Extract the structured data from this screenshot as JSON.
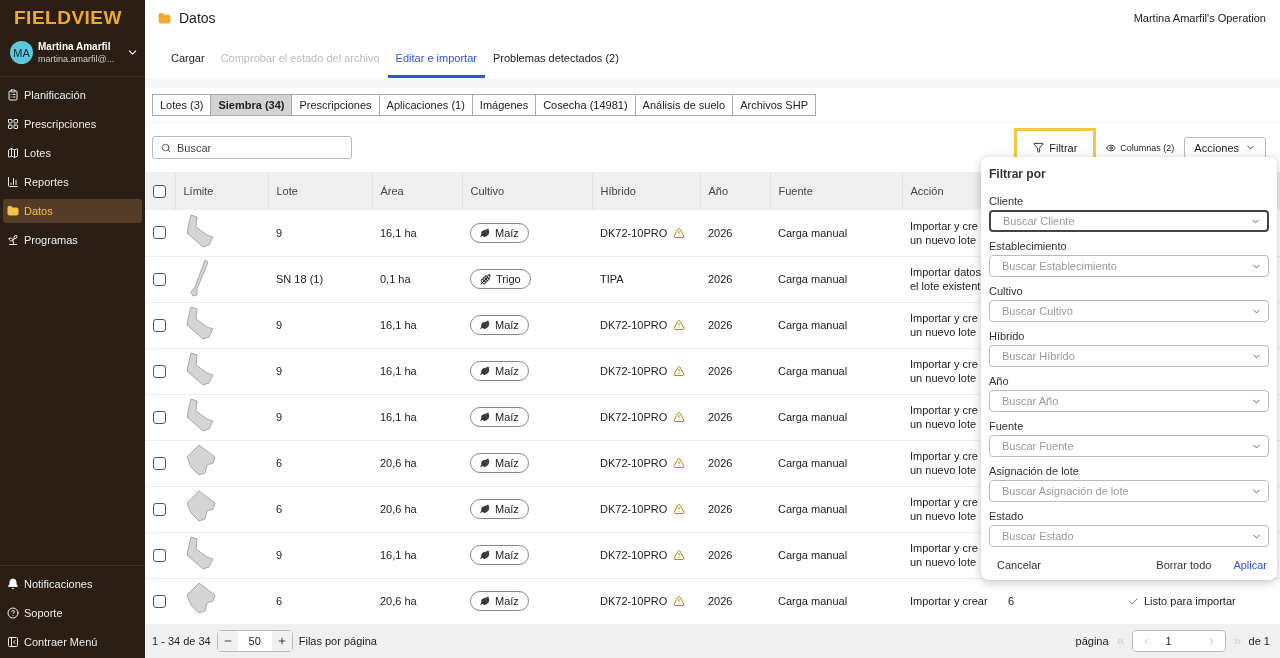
{
  "sidebar": {
    "logo": "FIELDVIEW",
    "user": {
      "initials": "MA",
      "name": "Martina Amarfil",
      "email": "martina.amarfil@..."
    },
    "items": [
      {
        "label": "Planificación",
        "selected": false
      },
      {
        "label": "Prescripciones",
        "selected": false
      },
      {
        "label": "Lotes",
        "selected": false
      },
      {
        "label": "Reportes",
        "selected": false
      },
      {
        "label": "Datos",
        "selected": true
      },
      {
        "label": "Programas",
        "selected": false
      }
    ],
    "bottom": [
      {
        "label": "Notificaciones"
      },
      {
        "label": "Soporte"
      },
      {
        "label": "Contraer Menú"
      }
    ]
  },
  "header": {
    "title": "Datos",
    "operation": "Martina Amarfil's Operation"
  },
  "steps": [
    {
      "label": "Cargar",
      "selected": false,
      "disabled": false
    },
    {
      "label": "Comprobar el estado del archivo",
      "selected": false,
      "disabled": true
    },
    {
      "label": "Editar e importar",
      "selected": true,
      "disabled": false
    },
    {
      "label": "Problemas detectados (2)",
      "selected": false,
      "disabled": false
    }
  ],
  "segments": [
    {
      "label": "Lotes (3)",
      "selected": false
    },
    {
      "label": "Siembra (34)",
      "selected": true
    },
    {
      "label": "Prescripciones",
      "selected": false
    },
    {
      "label": "Aplicaciones (1)",
      "selected": false
    },
    {
      "label": "Imágenes",
      "selected": false
    },
    {
      "label": "Cosecha (14981)",
      "selected": false
    },
    {
      "label": "Análisis de suelo",
      "selected": false
    },
    {
      "label": "Archivos SHP",
      "selected": false
    }
  ],
  "toolbar": {
    "search_placeholder": "Buscar",
    "filter": "Filtrar",
    "filter_highlighted": true,
    "columns": "Columnas (2)",
    "actions": "Acciones"
  },
  "table": {
    "all_checked": false,
    "columns": [
      "Límite",
      "Lote",
      "Área",
      "Cultivo",
      "Híbrido",
      "Año",
      "Fuente",
      "Acción"
    ],
    "rows": [
      {
        "checked": false,
        "lote": "9",
        "area": "16,1 ha",
        "crop": {
          "kind": "leaf",
          "label": "Maíz"
        },
        "hybrid": "DK72-10PRO",
        "warning": true,
        "year": "2026",
        "source": "Carga manual",
        "action": [
          "Importar y cre",
          "un nuevo lote"
        ]
      },
      {
        "checked": false,
        "lote": "SN 18 (1)",
        "area": "0,1 ha",
        "crop": {
          "kind": "wheat",
          "label": "Trigo"
        },
        "hybrid": "TIPA",
        "warning": false,
        "year": "2026",
        "source": "Carga manual",
        "action": [
          "Importar datos",
          "el lote existent"
        ]
      },
      {
        "checked": false,
        "lote": "9",
        "area": "16,1 ha",
        "crop": {
          "kind": "leaf",
          "label": "Maíz"
        },
        "hybrid": "DK72-10PRO",
        "warning": true,
        "year": "2026",
        "source": "Carga manual",
        "action": [
          "Importar y cre",
          "un nuevo lote"
        ]
      },
      {
        "checked": false,
        "lote": "9",
        "area": "16,1 ha",
        "crop": {
          "kind": "leaf",
          "label": "Maíz"
        },
        "hybrid": "DK72-10PRO",
        "warning": true,
        "year": "2026",
        "source": "Carga manual",
        "action": [
          "Importar y cre",
          "un nuevo lote"
        ]
      },
      {
        "checked": false,
        "lote": "9",
        "area": "16,1 ha",
        "crop": {
          "kind": "leaf",
          "label": "Maíz"
        },
        "hybrid": "DK72-10PRO",
        "warning": true,
        "year": "2026",
        "source": "Carga manual",
        "action": [
          "Importar y cre",
          "un nuevo lote"
        ]
      },
      {
        "checked": false,
        "lote": "6",
        "area": "20,6 ha",
        "crop": {
          "kind": "leaf",
          "label": "Maíz"
        },
        "hybrid": "DK72-10PRO",
        "warning": true,
        "year": "2026",
        "source": "Carga manual",
        "action": [
          "Importar y cre",
          "un nuevo lote"
        ]
      },
      {
        "checked": false,
        "lote": "6",
        "area": "20,6 ha",
        "crop": {
          "kind": "leaf",
          "label": "Maíz"
        },
        "hybrid": "DK72-10PRO",
        "warning": true,
        "year": "2026",
        "source": "Carga manual",
        "action": [
          "Importar y cre",
          "un nuevo lote"
        ]
      },
      {
        "checked": false,
        "lote": "9",
        "area": "16,1 ha",
        "crop": {
          "kind": "leaf",
          "label": "Maíz"
        },
        "hybrid": "DK72-10PRO",
        "warning": true,
        "year": "2026",
        "source": "Carga manual",
        "action": [
          "Importar y cre",
          "un nuevo lote"
        ]
      },
      {
        "checked": false,
        "lote": "6",
        "area": "20,6 ha",
        "crop": {
          "kind": "leaf",
          "label": "Maíz"
        },
        "hybrid": "DK72-10PRO",
        "warning": true,
        "year": "2026",
        "source": "Carga manual",
        "action": [
          "Importar y crear"
        ],
        "column_9": "6",
        "status": "Listo para importar"
      }
    ]
  },
  "pagination": {
    "range": "1 - 34 de 34",
    "per_page": "50",
    "per_page_label": "Filas por página",
    "page_label": "página",
    "page": "1",
    "of": "de 1"
  },
  "filter_panel": {
    "title": "Filtrar por",
    "fields": [
      {
        "label": "Cliente",
        "placeholder": "Buscar Cliente",
        "focused": true
      },
      {
        "label": "Establecimiento",
        "placeholder": "Buscar Establecimiento",
        "focused": false
      },
      {
        "label": "Cultivo",
        "placeholder": "Buscar Cultivo",
        "focused": false
      },
      {
        "label": "Híbrido",
        "placeholder": "Buscar Híbrido",
        "focused": false
      },
      {
        "label": "Año",
        "placeholder": "Buscar Año",
        "focused": false
      },
      {
        "label": "Fuente",
        "placeholder": "Buscar Fuente",
        "focused": false
      },
      {
        "label": "Asignación de lote",
        "placeholder": "Buscar Asignación de lote",
        "focused": false
      },
      {
        "label": "Estado",
        "placeholder": "Buscar Estado",
        "focused": false
      }
    ],
    "cancel": "Cancelar",
    "clear": "Borrar todo",
    "apply": "Aplicar"
  }
}
